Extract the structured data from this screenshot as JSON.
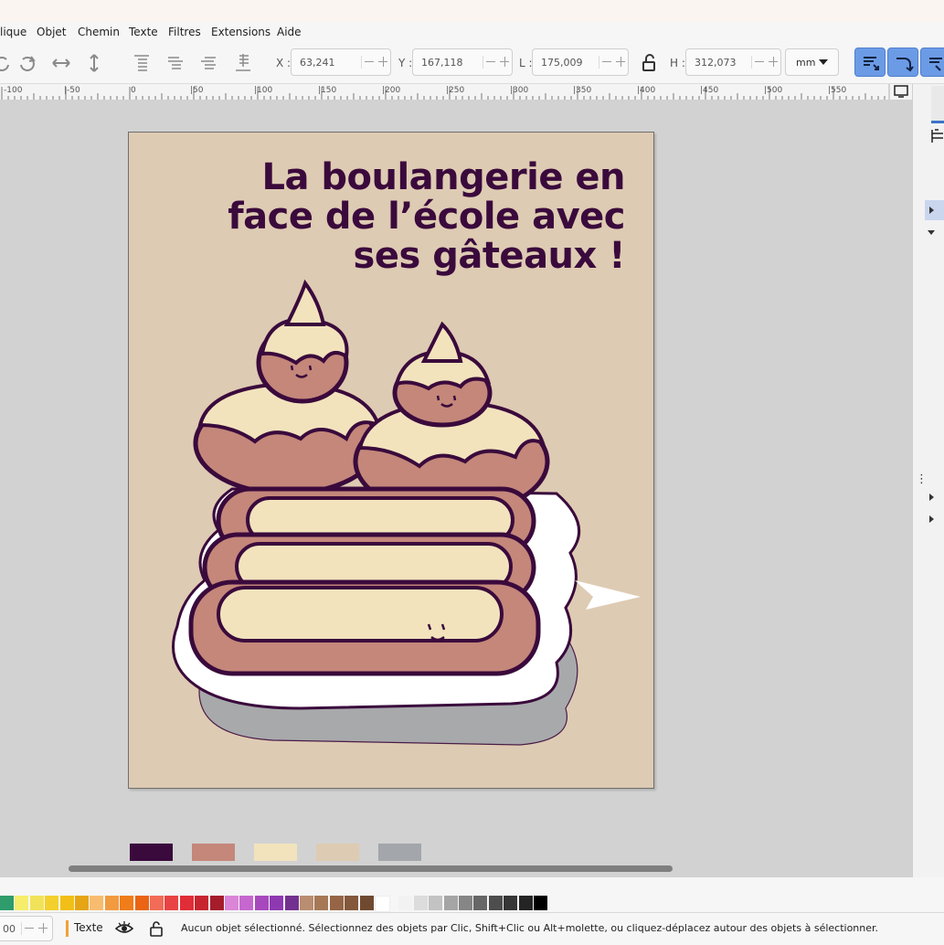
{
  "menu": [
    "lique",
    "Objet",
    "Chemin",
    "Texte",
    "Filtres",
    "Extensions",
    "Aide"
  ],
  "toolbar": {
    "x_label": "X :",
    "x_value": "63,241",
    "y_label": "Y :",
    "y_value": "167,118",
    "w_label": "L :",
    "w_value": "175,009",
    "h_label": "H :",
    "h_value": "312,073",
    "unit": "mm"
  },
  "ruler": {
    "labels": [
      "-100",
      "|-50",
      "0",
      "|50",
      "|100",
      "|150",
      "|200",
      "|250",
      "|300",
      "|350",
      "|400",
      "|450",
      "|500",
      "|550"
    ]
  },
  "poster": {
    "title_line1": "La boulangerie en",
    "title_line2": "face de l’école avec",
    "title_line3": "ses gâteaux !"
  },
  "colors": {
    "page": "#decbb3",
    "ink": "#3a0a3c",
    "pastry": "#c4877a",
    "cream": "#f2e3bd",
    "plate_shadow": "#a3a6ab"
  },
  "swatches": [
    "#3a0a3c",
    "#c4877a",
    "#f2e3bd",
    "#decbb3",
    "#a3a6ab"
  ],
  "palette": [
    "#2e9c6b",
    "#f6ee6a",
    "#f1e25a",
    "#f3d02c",
    "#f1bf17",
    "#e6a514",
    "#f7bc6f",
    "#f29a3f",
    "#f07c1a",
    "#ea6413",
    "#f26b57",
    "#ea4344",
    "#e02d37",
    "#c82430",
    "#a51d2a",
    "#da85d8",
    "#c667cf",
    "#a749bd",
    "#8e39b2",
    "#73318f",
    "#b98d6f",
    "#a67856",
    "#956545",
    "#83583b",
    "#6f4a31",
    "#ffffff",
    "#f2f2f2",
    "#dcdcdc",
    "#c3c3c3",
    "#a5a5a5",
    "#868686",
    "#676767",
    "#4d4d4d",
    "#363636",
    "#242424",
    "#000000"
  ],
  "status": {
    "layer": "Texte",
    "message": "Aucun objet sélectionné. Sélectionnez des objets par Clic, Shift+Clic ou Alt+molette, ou cliquez-déplacez autour des objets à sélectionner."
  }
}
